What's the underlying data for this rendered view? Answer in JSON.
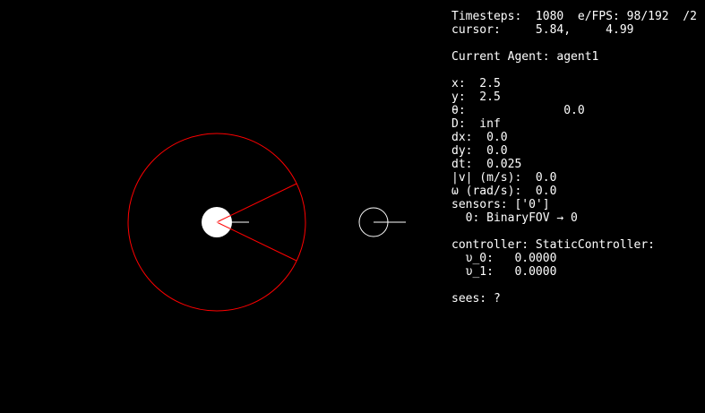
{
  "hud": {
    "timesteps": "Timesteps:  1080  e/FPS: 98/192  /2",
    "cursor": "cursor:     5.84,     4.99",
    "current_agent": "Current Agent: agent1",
    "x": "x:  2.5",
    "y": "y:  2.5",
    "theta": "θ:              0.0",
    "d": "D:  inf",
    "dx": "dx:  0.0",
    "dy": "dy:  0.0",
    "dt": "dt:  0.025",
    "speed": "|v| (m/s):  0.0",
    "omega": "ω (rad/s):  0.0",
    "sensors": "sensors: ['0']",
    "sensor_0": "  0: BinaryFOV → 0",
    "controller": "controller: StaticController:",
    "u0": "  υ_0:   0.0000",
    "u1": "  υ_1:   0.0000",
    "sees": "sees: ?"
  },
  "colors": {
    "background": "#000000",
    "text": "#ffffff",
    "sensor_fov": "#ff0000",
    "agent_fill": "#ffffff",
    "other_agent_outline": "#ffffff"
  }
}
